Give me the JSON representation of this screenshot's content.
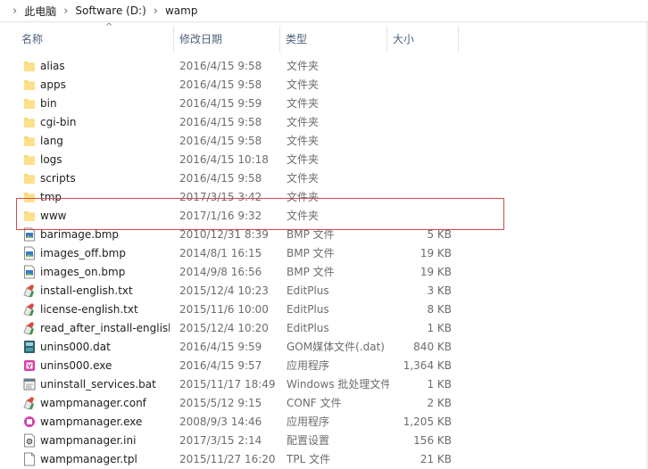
{
  "breadcrumb": [
    "此电脑",
    "Software (D:)",
    "wamp"
  ],
  "columns": {
    "name": "名称",
    "modified": "修改日期",
    "type": "类型",
    "size": "大小"
  },
  "files": [
    {
      "name": "alias",
      "modified": "2016/4/15 9:58",
      "type": "文件夹",
      "size": "",
      "icon": "folder-icon"
    },
    {
      "name": "apps",
      "modified": "2016/4/15 9:58",
      "type": "文件夹",
      "size": "",
      "icon": "folder-icon"
    },
    {
      "name": "bin",
      "modified": "2016/4/15 9:59",
      "type": "文件夹",
      "size": "",
      "icon": "folder-icon"
    },
    {
      "name": "cgi-bin",
      "modified": "2016/4/15 9:58",
      "type": "文件夹",
      "size": "",
      "icon": "folder-icon"
    },
    {
      "name": "lang",
      "modified": "2016/4/15 9:58",
      "type": "文件夹",
      "size": "",
      "icon": "folder-icon"
    },
    {
      "name": "logs",
      "modified": "2016/4/15 10:18",
      "type": "文件夹",
      "size": "",
      "icon": "folder-icon"
    },
    {
      "name": "scripts",
      "modified": "2016/4/15 9:58",
      "type": "文件夹",
      "size": "",
      "icon": "folder-icon"
    },
    {
      "name": "tmp",
      "modified": "2017/3/15 3:42",
      "type": "文件夹",
      "size": "",
      "icon": "folder-icon"
    },
    {
      "name": "www",
      "modified": "2017/1/16 9:32",
      "type": "文件夹",
      "size": "",
      "icon": "folder-icon"
    },
    {
      "name": "barimage.bmp",
      "modified": "2010/12/31 8:39",
      "type": "BMP 文件",
      "size": "5 KB",
      "icon": "bitmap-icon"
    },
    {
      "name": "images_off.bmp",
      "modified": "2014/8/1 16:15",
      "type": "BMP 文件",
      "size": "19 KB",
      "icon": "bitmap-icon"
    },
    {
      "name": "images_on.bmp",
      "modified": "2014/9/8 16:56",
      "type": "BMP 文件",
      "size": "19 KB",
      "icon": "bitmap-icon"
    },
    {
      "name": "install-english.txt",
      "modified": "2015/12/4 10:23",
      "type": "EditPlus",
      "size": "3 KB",
      "icon": "editplus-icon"
    },
    {
      "name": "license-english.txt",
      "modified": "2015/11/6 10:00",
      "type": "EditPlus",
      "size": "8 KB",
      "icon": "editplus-icon"
    },
    {
      "name": "read_after_install-english.txt",
      "modified": "2015/12/4 10:20",
      "type": "EditPlus",
      "size": "1 KB",
      "icon": "editplus-icon"
    },
    {
      "name": "unins000.dat",
      "modified": "2016/4/15 9:59",
      "type": "GOM媒体文件(.dat)",
      "size": "840 KB",
      "icon": "dat-file-icon"
    },
    {
      "name": "unins000.exe",
      "modified": "2016/4/15 9:57",
      "type": "应用程序",
      "size": "1,364 KB",
      "icon": "installer-icon"
    },
    {
      "name": "uninstall_services.bat",
      "modified": "2015/11/17 18:49",
      "type": "Windows 批处理文件",
      "size": "1 KB",
      "icon": "batch-file-icon"
    },
    {
      "name": "wampmanager.conf",
      "modified": "2015/5/12 9:15",
      "type": "CONF 文件",
      "size": "2 KB",
      "icon": "editplus-icon"
    },
    {
      "name": "wampmanager.exe",
      "modified": "2008/9/3 14:46",
      "type": "应用程序",
      "size": "1,205 KB",
      "icon": "wamp-app-icon"
    },
    {
      "name": "wampmanager.ini",
      "modified": "2017/3/15 2:14",
      "type": "配置设置",
      "size": "156 KB",
      "icon": "settings-file-icon"
    },
    {
      "name": "wampmanager.tpl",
      "modified": "2015/11/27 16:20",
      "type": "TPL 文件",
      "size": "21 KB",
      "icon": "blank-file-icon"
    }
  ],
  "highlighted_file": "www"
}
